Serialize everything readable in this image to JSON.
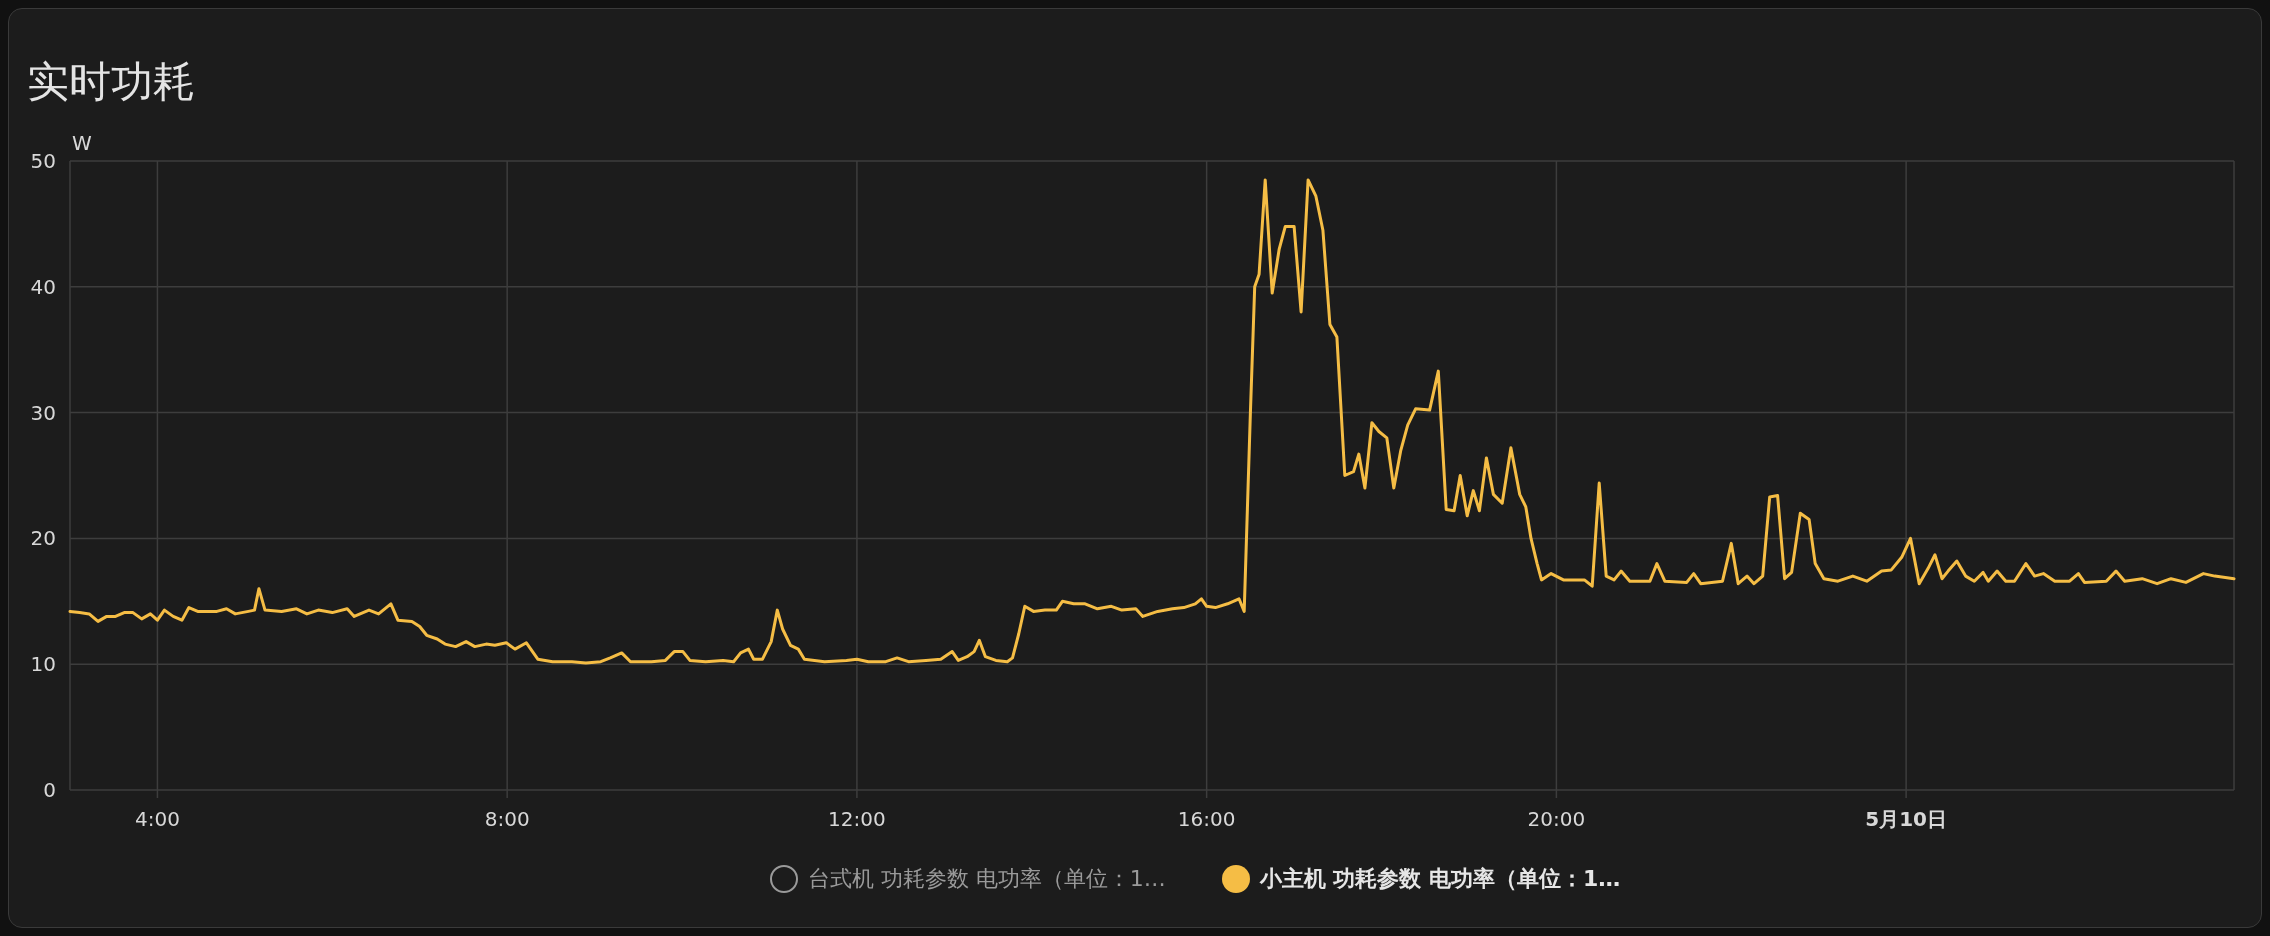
{
  "card": {
    "title": "实时功耗",
    "chart_data": {
      "type": "line",
      "ylabel": "W",
      "xlim": [
        3,
        27.75
      ],
      "ylim": [
        0,
        50
      ],
      "yticks": [
        0,
        10,
        20,
        30,
        40,
        50
      ],
      "grid": true,
      "xticks": [
        {
          "value": 4,
          "label": "4:00"
        },
        {
          "value": 8,
          "label": "8:00"
        },
        {
          "value": 12,
          "label": "12:00"
        },
        {
          "value": 16,
          "label": "16:00"
        },
        {
          "value": 20,
          "label": "20:00"
        },
        {
          "value": 24,
          "label": "5月10日"
        }
      ],
      "x": [
        3.0,
        3.11,
        3.22,
        3.32,
        3.42,
        3.52,
        3.62,
        3.72,
        3.82,
        3.92,
        4.0,
        4.08,
        4.18,
        4.28,
        4.36,
        4.46,
        4.68,
        4.79,
        4.89,
        5.04,
        5.11,
        5.16,
        5.23,
        5.42,
        5.59,
        5.71,
        5.84,
        6.0,
        6.17,
        6.25,
        6.42,
        6.53,
        6.67,
        6.75,
        6.91,
        7.0,
        7.08,
        7.2,
        7.29,
        7.41,
        7.53,
        7.63,
        7.76,
        7.86,
        7.99,
        8.09,
        8.22,
        8.35,
        8.52,
        8.74,
        8.9,
        9.07,
        9.18,
        9.31,
        9.41,
        9.65,
        9.81,
        9.91,
        10.01,
        10.09,
        10.27,
        10.47,
        10.59,
        10.67,
        10.76,
        10.82,
        10.92,
        11.02,
        11.09,
        11.15,
        11.24,
        11.33,
        11.4,
        11.63,
        11.88,
        12.0,
        12.13,
        12.33,
        12.46,
        12.59,
        12.79,
        12.96,
        13.09,
        13.16,
        13.26,
        13.34,
        13.4,
        13.47,
        13.59,
        13.72,
        13.78,
        13.85,
        13.92,
        14.02,
        14.15,
        14.28,
        14.35,
        14.48,
        14.61,
        14.75,
        14.91,
        15.03,
        15.19,
        15.27,
        15.44,
        15.61,
        15.74,
        15.87,
        15.94,
        16.0,
        16.1,
        16.24,
        16.37,
        16.43,
        16.5,
        16.55,
        16.6,
        16.67,
        16.75,
        16.83,
        16.9,
        17.0,
        17.08,
        17.16,
        17.25,
        17.33,
        17.41,
        17.49,
        17.58,
        17.68,
        17.74,
        17.81,
        17.89,
        17.97,
        18.06,
        18.14,
        18.22,
        18.3,
        18.39,
        18.55,
        18.65,
        18.74,
        18.83,
        18.9,
        18.98,
        19.05,
        19.12,
        19.2,
        19.28,
        19.38,
        19.48,
        19.58,
        19.65,
        19.71,
        19.78,
        19.83,
        19.94,
        20.08,
        20.32,
        20.41,
        20.49,
        20.57,
        20.66,
        20.74,
        20.84,
        21.07,
        21.15,
        21.24,
        21.49,
        21.57,
        21.65,
        21.9,
        22.0,
        22.08,
        22.18,
        22.26,
        22.36,
        22.44,
        22.53,
        22.61,
        22.69,
        22.79,
        22.89,
        22.96,
        23.06,
        23.22,
        23.39,
        23.55,
        23.72,
        23.83,
        23.95,
        24.05,
        24.15,
        24.25,
        24.33,
        24.41,
        24.48,
        24.58,
        24.68,
        24.78,
        24.88,
        24.94,
        25.04,
        25.14,
        25.24,
        25.37,
        25.47,
        25.57,
        25.7,
        25.87,
        25.97,
        26.04,
        26.29,
        26.4,
        26.5,
        26.7,
        26.87,
        27.03,
        27.2,
        27.4,
        27.53,
        27.75
      ],
      "series": [
        {
          "color": "#f5bd45",
          "values": [
            14.2,
            14.1,
            14,
            13.4,
            13.8,
            13.8,
            14.1,
            14.1,
            13.6,
            14,
            13.5,
            14.3,
            13.8,
            13.5,
            14.5,
            14.2,
            14.2,
            14.4,
            14,
            14.2,
            14.3,
            16,
            14.3,
            14.2,
            14.4,
            14,
            14.3,
            14.1,
            14.4,
            13.8,
            14.3,
            14,
            14.8,
            13.5,
            13.4,
            13,
            12.3,
            12,
            11.6,
            11.4,
            11.8,
            11.4,
            11.6,
            11.5,
            11.7,
            11.2,
            11.7,
            10.4,
            10.2,
            10.2,
            10.1,
            10.2,
            10.5,
            10.9,
            10.2,
            10.2,
            10.3,
            11,
            11,
            10.3,
            10.2,
            10.3,
            10.2,
            10.9,
            11.2,
            10.4,
            10.4,
            11.8,
            14.3,
            12.8,
            11.5,
            11.2,
            10.4,
            10.2,
            10.3,
            10.4,
            10.2,
            10.2,
            10.5,
            10.2,
            10.3,
            10.4,
            11,
            10.3,
            10.6,
            11,
            11.9,
            10.6,
            10.3,
            10.2,
            10.5,
            12.4,
            14.6,
            14.2,
            14.3,
            14.3,
            15,
            14.8,
            14.8,
            14.4,
            14.6,
            14.3,
            14.4,
            13.8,
            14.2,
            14.4,
            14.5,
            14.8,
            15.2,
            14.6,
            14.5,
            14.8,
            15.2,
            14.2,
            30,
            40,
            41,
            48.5,
            39.5,
            43,
            44.8,
            44.8,
            38,
            48.5,
            47.2,
            44.5,
            37,
            36,
            25,
            25.3,
            26.7,
            24,
            29.2,
            28.5,
            28,
            24,
            27,
            29,
            30.3,
            30.2,
            33.3,
            22.3,
            22.2,
            25,
            21.8,
            23.8,
            22.2,
            26.4,
            23.5,
            22.8,
            27.2,
            23.5,
            22.5,
            20,
            18,
            16.7,
            17.2,
            16.7,
            16.7,
            16.2,
            24.4,
            17,
            16.7,
            17.4,
            16.6,
            16.6,
            18,
            16.6,
            16.5,
            17.2,
            16.4,
            16.6,
            19.6,
            16.4,
            17,
            16.4,
            17,
            23.3,
            23.4,
            16.8,
            17.3,
            22,
            21.5,
            18,
            16.8,
            16.6,
            17,
            16.6,
            17.4,
            17.5,
            18.5,
            20,
            16.4,
            17.6,
            18.7,
            16.8,
            17.4,
            18.2,
            17,
            16.6,
            17.3,
            16.6,
            17.4,
            16.6,
            16.6,
            18,
            17,
            17.2,
            16.6,
            16.6,
            17.2,
            16.5,
            16.6,
            17.4,
            16.6,
            16.8,
            16.4,
            16.8,
            16.5,
            17.2,
            17,
            16.8
          ]
        }
      ]
    },
    "legend": [
      {
        "label": "台式机 功耗参数 电功率（单位：1…",
        "selected": false
      },
      {
        "label": "小主机 功耗参数 电功率（单位：1…",
        "selected": true,
        "color": "#f5bd45"
      }
    ]
  }
}
